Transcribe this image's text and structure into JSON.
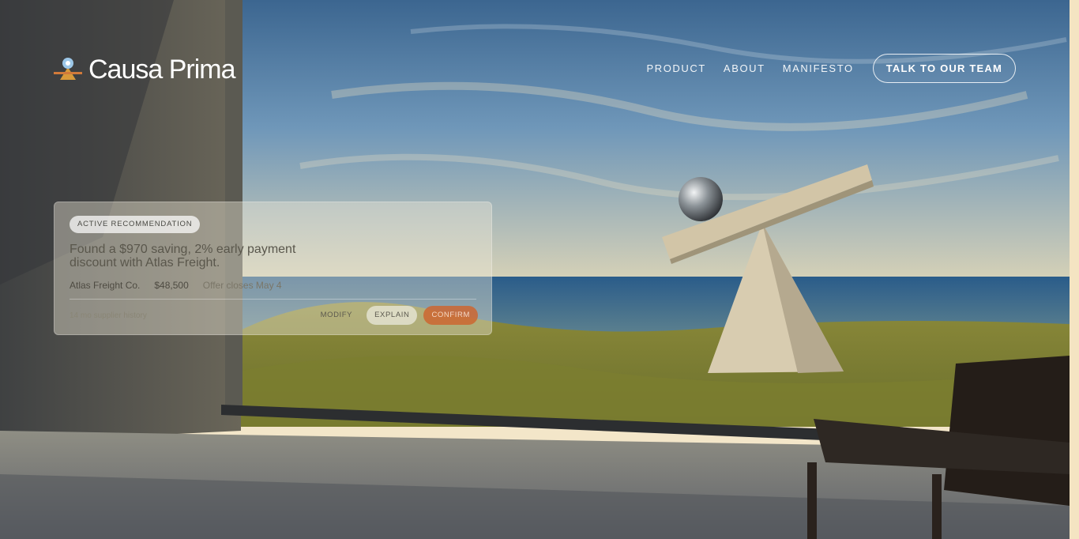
{
  "brand": {
    "name": "Causa Prima"
  },
  "nav": {
    "links": [
      "PRODUCT",
      "ABOUT",
      "MANIFESTO"
    ],
    "cta": "TALK TO OUR TEAM"
  },
  "card": {
    "badge": "ACTIVE RECOMMENDATION",
    "headline": "Found a $970 saving, 2% early payment discount with Atlas Freight.",
    "supplier": "Atlas Freight Co.",
    "amount": "$48,500",
    "deadline": "Offer closes May 4",
    "history": "14 mo supplier history",
    "actions": {
      "modify": "MODIFY",
      "explain": "EXPLAIN",
      "confirm": "CONFIRM"
    }
  },
  "icons": {
    "logo": "location-pin-icon"
  },
  "colors": {
    "accent": "#cd6630",
    "logo_pin": "#9cc7e8",
    "logo_base": "#d89a3a"
  }
}
